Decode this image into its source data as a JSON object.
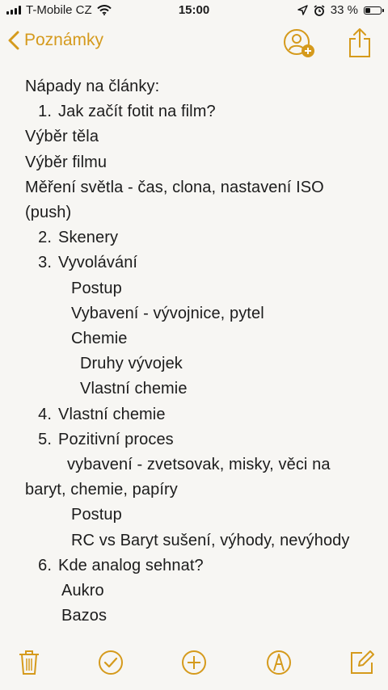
{
  "status_bar": {
    "carrier": "T-Mobile CZ",
    "time": "15:00",
    "battery_percent": "33 %",
    "battery_level": 0.33
  },
  "nav": {
    "back_label": "Poznámky",
    "icons": [
      "chevron-left-icon",
      "add-person-icon",
      "share-icon"
    ]
  },
  "note": {
    "title": "Nápady na články:",
    "lines": [
      {
        "num": "1.",
        "text": "Jak začít fotit na film?"
      },
      {
        "text": "Výběr těla"
      },
      {
        "text": "Výběr filmu"
      },
      {
        "text": "Měření světla - čas, clona, nastavení ISO (push)"
      },
      {
        "num": "2.",
        "text": "Skenery"
      },
      {
        "num": "3.",
        "text": "Vyvolávání"
      },
      {
        "text": "Postup"
      },
      {
        "text": "Vybavení - vývojnice, pytel"
      },
      {
        "text": "Chemie"
      },
      {
        "text": "Druhy vývojek"
      },
      {
        "text": "Vlastní chemie"
      },
      {
        "num": "4.",
        "text": "Vlastní chemie"
      },
      {
        "num": "5.",
        "text": "Pozitivní proces"
      },
      {
        "text": "vybavení - zvetsovak, misky, věci na baryt, chemie, papíry"
      },
      {
        "text": "Postup"
      },
      {
        "text": "RC vs Baryt sušení, výhody, nevýhody"
      },
      {
        "num": "6.",
        "text": "Kde analog sehnat?"
      },
      {
        "text": "Aukro"
      },
      {
        "text": "Bazos"
      }
    ]
  },
  "toolbar": {
    "icons": [
      "trash-icon",
      "checklist-icon",
      "add-icon",
      "sketch-icon",
      "compose-icon"
    ]
  },
  "colors": {
    "accent": "#d59a1c",
    "background": "#f7f6f3",
    "text": "#1c1c1c"
  }
}
